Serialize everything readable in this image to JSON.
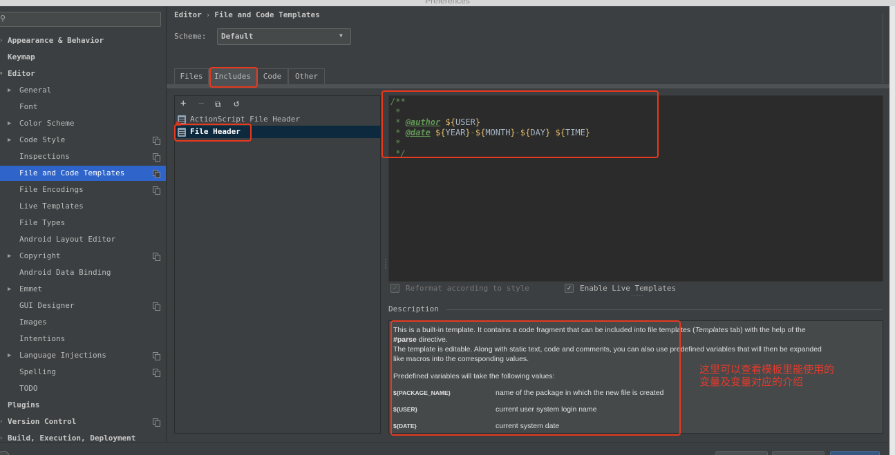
{
  "window": {
    "title": "Preferences"
  },
  "search": {
    "placeholder": ""
  },
  "sidebar": {
    "items": [
      {
        "label": "Appearance & Behavior",
        "bold": true,
        "arrow": "›",
        "indent": 0
      },
      {
        "label": "Keymap",
        "bold": true,
        "indent": 0
      },
      {
        "label": "Editor",
        "bold": true,
        "arrow": "▾",
        "indent": 0
      },
      {
        "label": "General",
        "arrow": "▶",
        "indent": 1
      },
      {
        "label": "Font",
        "indent": 1
      },
      {
        "label": "Color Scheme",
        "arrow": "▶",
        "indent": 1
      },
      {
        "label": "Code Style",
        "arrow": "▶",
        "indent": 1,
        "copy": true
      },
      {
        "label": "Inspections",
        "indent": 1,
        "copy": true
      },
      {
        "label": "File and Code Templates",
        "indent": 1,
        "copy": true,
        "selected": true
      },
      {
        "label": "File Encodings",
        "indent": 1,
        "copy": true
      },
      {
        "label": "Live Templates",
        "indent": 1
      },
      {
        "label": "File Types",
        "indent": 1
      },
      {
        "label": "Android Layout Editor",
        "indent": 1
      },
      {
        "label": "Copyright",
        "arrow": "▶",
        "indent": 1,
        "copy": true
      },
      {
        "label": "Android Data Binding",
        "indent": 1
      },
      {
        "label": "Emmet",
        "arrow": "▶",
        "indent": 1
      },
      {
        "label": "GUI Designer",
        "indent": 1,
        "copy": true
      },
      {
        "label": "Images",
        "indent": 1
      },
      {
        "label": "Intentions",
        "indent": 1
      },
      {
        "label": "Language Injections",
        "arrow": "▶",
        "indent": 1,
        "copy": true
      },
      {
        "label": "Spelling",
        "indent": 1,
        "copy": true
      },
      {
        "label": "TODO",
        "indent": 1
      },
      {
        "label": "Plugins",
        "bold": true,
        "indent": 0
      },
      {
        "label": "Version Control",
        "bold": true,
        "arrow": "›",
        "indent": 0,
        "copy": true
      },
      {
        "label": "Build, Execution, Deployment",
        "bold": true,
        "arrow": "›",
        "indent": 0
      }
    ]
  },
  "breadcrumb": {
    "root": "Editor",
    "separator": "›",
    "current": "File and Code Templates"
  },
  "scheme": {
    "label": "Scheme:",
    "value": "Default"
  },
  "tabs": [
    {
      "label": "Files"
    },
    {
      "label": "Includes",
      "active": true
    },
    {
      "label": "Code"
    },
    {
      "label": "Other"
    }
  ],
  "toolbar": {
    "add": "+",
    "remove": "−",
    "copy": "⧉",
    "reset": "↺"
  },
  "templates": [
    {
      "label": "ActionScript File Header"
    },
    {
      "label": "File Header",
      "selected": true
    }
  ],
  "editor": {
    "line1": "/**",
    "line2": " *",
    "line3_prefix": " * ",
    "line3_tag": "@author",
    "line3_var": "USER",
    "line4_prefix": " * ",
    "line4_tag": "@date",
    "line4_vars": [
      "YEAR",
      "MONTH",
      "DAY",
      "TIME"
    ],
    "line5": " *",
    "line6": " */"
  },
  "options": {
    "reformat": {
      "label": "Reformat according to style",
      "checked": true,
      "disabled": true
    },
    "live_templates": {
      "label": "Enable Live Templates",
      "checked": true
    }
  },
  "description": {
    "title": "Description",
    "p1_a": "This is a built-in template. It contains a code fragment that can be included into file templates (",
    "p1_em": "Templates",
    "p1_b": " tab) with the help of the",
    "p1_c_bold": "#parse",
    "p1_c": " directive.",
    "p2_a": "The template is editable. Along with static text, code and comments, you can also use predefined variables that will then be expanded",
    "p2_b": "like macros into the corresponding values.",
    "p3": "Predefined variables will take the following values:",
    "vars": [
      {
        "name": "${PACKAGE_NAME}",
        "desc": "name of the package in which the new file is created"
      },
      {
        "name": "${USER}",
        "desc": "current user system login name"
      },
      {
        "name": "${DATE}",
        "desc": "current system date"
      }
    ]
  },
  "annotation": {
    "line1": "这里可以查看模板里能使用的",
    "line2": "变量及变量对应的介绍"
  },
  "colors": {
    "highlight": "#e8391f",
    "selection": "#2f65ca",
    "comment": "#629755"
  }
}
